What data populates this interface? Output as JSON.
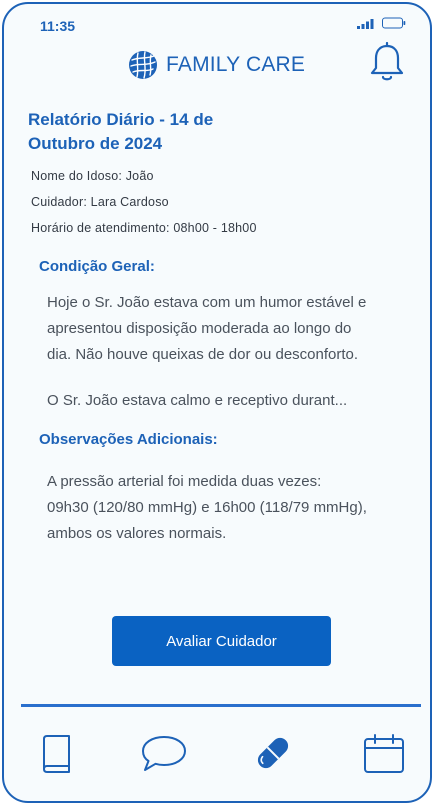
{
  "status_bar": {
    "time": "11:35",
    "signal_icon": "signal-bars-icon",
    "battery_icon": "battery-icon"
  },
  "header": {
    "brand": "FAMILY CARE",
    "logo_icon": "globe-logo-icon",
    "notification_icon": "bell-icon"
  },
  "report": {
    "title_line1": "Relatório Diário - 14 de",
    "title_line2": "Outubro de 2024",
    "patient": "Nome do Idoso: João",
    "caregiver": "Cuidador: Lara Cardoso",
    "hours": "Horário de atendimento: 08h00 - 18h00"
  },
  "sections": {
    "general": {
      "title": "Condição Geral:",
      "line1": "Hoje o Sr. João estava com um humor estável e",
      "line2": "apresentou disposição moderada ao longo do",
      "line3": "dia. Não houve queixas de dor ou desconforto.",
      "line4": "O Sr. João estava calmo e receptivo durant..."
    },
    "notes": {
      "title": "Observações Adicionais:",
      "line1": "A pressão arterial foi medida duas vezes:",
      "line2": "09h30 (120/80 mmHg) e 16h00 (118/79 mmHg),",
      "line3": "ambos os valores normais."
    }
  },
  "actions": {
    "rate_caregiver": "Avaliar Cuidador"
  },
  "bottom_nav": {
    "items": [
      "book-icon",
      "chat-bubble-icon",
      "pill-icon",
      "calendar-icon"
    ]
  },
  "colors": {
    "primary": "#1d62b7",
    "button": "#0a62c2",
    "background": "#f7fbfd",
    "text": "#4a525c"
  }
}
